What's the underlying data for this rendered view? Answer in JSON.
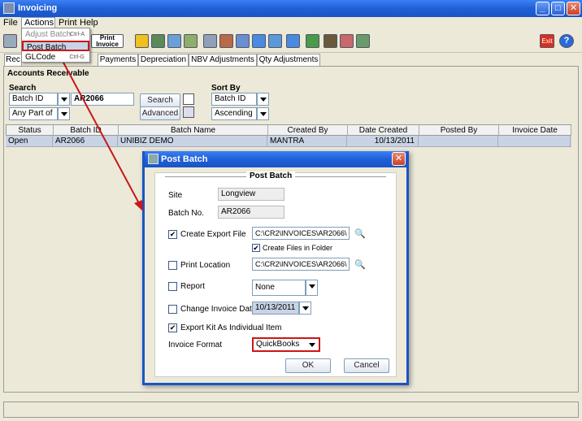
{
  "window": {
    "title": "Invoicing"
  },
  "menu": {
    "items": [
      "File",
      "Actions",
      "Print",
      "Help"
    ]
  },
  "dropdown": {
    "items": [
      {
        "label": "Adjust Batch",
        "shortcut": "Ctrl-A"
      },
      {
        "label": "Post Batch",
        "shortcut": ""
      },
      {
        "label": "GLCode",
        "shortcut": "Ctrl-G"
      }
    ]
  },
  "toolbar": {
    "print_invoice_label": "Print\nInvoice",
    "exit_label": "Exit"
  },
  "tabs": [
    "Rec",
    "Payments",
    "Depreciation",
    "NBV Adjustments",
    "Qty Adjustments"
  ],
  "section": {
    "title": "Accounts Receivable"
  },
  "search": {
    "label": "Search",
    "field": "Batch ID",
    "value": "AR2066",
    "match": "Any Part of ...",
    "search_button": "Search",
    "advanced_button": "Advanced"
  },
  "sort": {
    "label": "Sort By",
    "field": "Batch ID",
    "order": "Ascending"
  },
  "grid": {
    "columns": [
      "Status",
      "Batch ID",
      "Batch Name",
      "Created By",
      "Date Created",
      "Posted By",
      "Invoice Date"
    ],
    "rows": [
      [
        "Open",
        "AR2066",
        "UNIBIZ DEMO",
        "MANTRA",
        "10/13/2011",
        "",
        ""
      ]
    ]
  },
  "modal": {
    "title": "Post Batch",
    "group_title": "Post Batch",
    "site_label": "Site",
    "site_value": "Longview",
    "batch_label": "Batch No.",
    "batch_value": "AR2066",
    "create_export_label": "Create Export File",
    "create_export_path": "C:\\CR2\\INVOICES\\AR2066\\",
    "create_files_folder_label": "Create Files in Folder",
    "print_location_label": "Print Location",
    "print_location_path": "C:\\CR2\\INVOICES\\AR2066\\",
    "report_label": "Report",
    "report_value": "None",
    "change_date_label": "Change Invoice Date",
    "change_date_value": "10/13/2011",
    "export_kit_label": "Export Kit As Individual Item",
    "invoice_format_label": "Invoice Format",
    "invoice_format_value": "QuickBooks",
    "ok_label": "OK",
    "cancel_label": "Cancel"
  },
  "colors": {
    "titlebar": "#1f5fd6",
    "highlight": "#c81818",
    "row_selected": "#c8d4e6"
  }
}
